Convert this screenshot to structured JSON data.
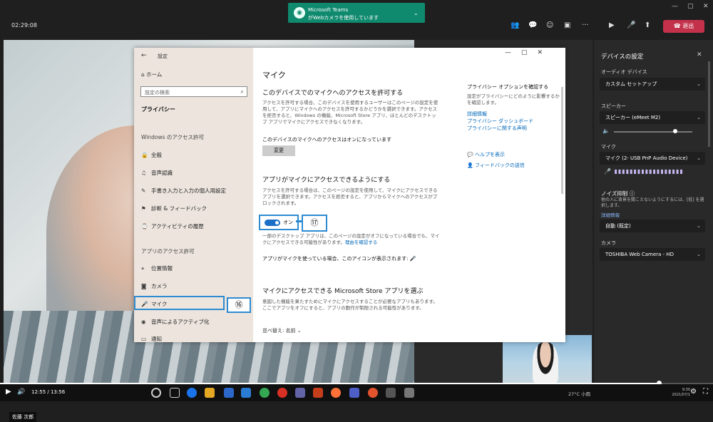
{
  "topbar": {
    "elapsed": "02:29:08",
    "toast_title": "Microsoft Teams",
    "toast_text": "がWebカメラを使用しています",
    "leave_label": "退出"
  },
  "video": {
    "participant_name": "佐藤 次郎"
  },
  "settings_window": {
    "title": "設定",
    "nav": {
      "home": "ホーム",
      "search_placeholder": "設定の検索",
      "section_title": "プライバシー",
      "windows_perm_header": "Windows のアクセス許可",
      "windows_items": [
        "全般",
        "音声認識",
        "手書き入力と入力の個人用設定",
        "診断 & フィードバック",
        "アクティビティの履歴"
      ],
      "app_perm_header": "アプリのアクセス許可",
      "app_items": [
        "位置情報",
        "カメラ",
        "マイク",
        "音声によるアクティブ化",
        "通知"
      ]
    },
    "main": {
      "heading": "マイク",
      "section1_title": "このデバイスでのマイクへのアクセスを許可する",
      "section1_text": "アクセスを許可する場合、このデバイスを使用するユーザーはこのページの設定を使用して、アプリにマイクへのアクセスを許可するかどうかを選択できます。アクセスを拒否すると、Windows の機能、Microsoft Store アプリ、ほとんどのデスクトップ アプリでマイクにアクセスできなくなります。",
      "status_text": "このデバイスのマイクへのアクセスはオンになっています",
      "change_button": "変更",
      "section2_title": "アプリがマイクにアクセスできるようにする",
      "section2_text": "アクセスを許可する場合は、このページの設定を使用して、マイクにアクセスできるアプリを選択できます。アクセスを拒否すると、アプリからマイクへのアクセスがブロックされます。",
      "toggle_label": "オン",
      "annotation_17": "⑰",
      "note_text": "一部のデスクトップ アプリは、このページの設定がオフになっている場合でも、マイクにアクセスできる可能性があります。",
      "note_link": "理由を確認する",
      "mic_icon_note": "アプリがマイクを使っている場合、このアイコンが表示されます:",
      "section3_title": "マイクにアクセスできる Microsoft Store アプリを選ぶ",
      "section3_text": "意図した機能を果たすためにマイクにアクセスすることが必要なアプリもあります。ここでアプリをオフにすると、アプリの動作が制限される可能性があります。",
      "sort_label": "並べ替え: 名前"
    },
    "right": {
      "title": "プライバシー オプションを確認する",
      "desc": "設定がプライバシーにどのように影響するかを確認します。",
      "links": [
        "詳細情報",
        "プライバシー ダッシュボード",
        "プライバシーに関する声明"
      ],
      "help": "ヘルプを表示",
      "feedback": "フィードバックの送信"
    },
    "annotation_16": "⑯"
  },
  "device_panel": {
    "title": "デバイスの設定",
    "audio_label": "オーディオ デバイス",
    "audio_value": "カスタム セットアップ",
    "speaker_label": "スピーカー",
    "speaker_value": "スピーカー (eMeet M2)",
    "speaker_volume": 0.78,
    "mic_label": "マイク",
    "mic_value": "マイク (2- USB PnP Audio Device)",
    "noise_label": "ノイズ抑制",
    "noise_desc": "他の人に背景を聞こえないようにするには、[低] を選択します。",
    "noise_link": "詳細情報",
    "noise_value": "自動 (既定)",
    "camera_label": "カメラ",
    "camera_value": "TOSHIBA Web Camera - HD"
  },
  "player": {
    "time": "12:55 / 13:56",
    "progress": 0.925,
    "weather": "27°C 小雨",
    "clock": "9:30",
    "date": "2021/07/1"
  }
}
